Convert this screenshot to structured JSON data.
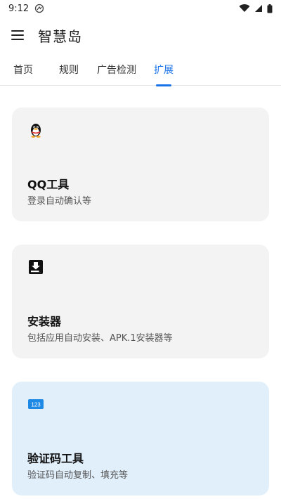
{
  "status": {
    "time": "9:12"
  },
  "app": {
    "title": "智慧岛"
  },
  "tabs": [
    {
      "label": "首页",
      "active": false
    },
    {
      "label": "规则",
      "active": false
    },
    {
      "label": "广告检测",
      "active": false
    },
    {
      "label": "扩展",
      "active": true
    }
  ],
  "cards": [
    {
      "icon": "qq-penguin-icon",
      "title": "QQ工具",
      "subtitle": "登录自动确认等"
    },
    {
      "icon": "installer-download-icon",
      "title": "安装器",
      "subtitle": "包括应用自动安装、APK.1安装器等"
    },
    {
      "icon": "number-123-icon",
      "icon_text": "123",
      "title": "验证码工具",
      "subtitle": "验证码自动复制、填充等"
    }
  ],
  "colors": {
    "accent": "#1a73e8",
    "card_bg": "#f3f3f3",
    "card_highlight_bg": "#e1effb"
  }
}
